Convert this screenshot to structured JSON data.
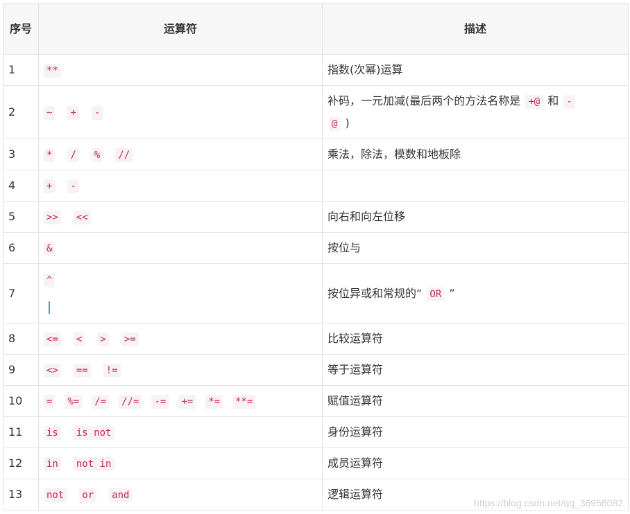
{
  "header": {
    "col_no": "序号",
    "col_op": "运算符",
    "col_desc": "描述"
  },
  "rows": [
    {
      "no": "1",
      "ops": [
        "**"
      ],
      "desc": "指数(次幂)运算"
    },
    {
      "no": "2",
      "ops": [
        "~",
        "+",
        "-"
      ],
      "desc_parts": [
        "补码，一元加减(最后两个的方法名称是",
        "+@",
        "和",
        "-",
        "@",
        ")"
      ]
    },
    {
      "no": "3",
      "ops": [
        "*",
        "/",
        "%",
        "//"
      ],
      "desc": "乘法，除法，模数和地板除"
    },
    {
      "no": "4",
      "ops": [
        "+",
        "-"
      ],
      "desc": ""
    },
    {
      "no": "5",
      "ops": [
        ">>",
        "<<"
      ],
      "desc": "向右和向左位移"
    },
    {
      "no": "6",
      "ops": [
        "&"
      ],
      "desc": "按位与"
    },
    {
      "no": "7",
      "ops": [
        "^"
      ],
      "desc_parts": [
        "按位异或和常规的“",
        "OR",
        "”"
      ]
    },
    {
      "no": "8",
      "ops": [
        "<=",
        "<",
        ">",
        ">="
      ],
      "desc": "比较运算符"
    },
    {
      "no": "9",
      "ops": [
        "<>",
        "==",
        "!="
      ],
      "desc": "等于运算符"
    },
    {
      "no": "10",
      "ops": [
        "=",
        "%=",
        "/=",
        "//=",
        "-=",
        "+=",
        "*=",
        "**="
      ],
      "desc": "赋值运算符"
    },
    {
      "no": "11",
      "ops": [
        "is",
        "is not"
      ],
      "desc": "身份运算符"
    },
    {
      "no": "12",
      "ops": [
        "in",
        "not in"
      ],
      "desc": "成员运算符"
    },
    {
      "no": "13",
      "ops": [
        "not",
        "or",
        "and"
      ],
      "desc": "逻辑运算符"
    }
  ],
  "watermark": "https://blog.csdn.net/qq_36956082",
  "colors": {
    "code_text": "#c7254e",
    "code_bg": "#f9f2f4",
    "border": "#e3e3e3",
    "header_bg": "#f7f7f7"
  }
}
